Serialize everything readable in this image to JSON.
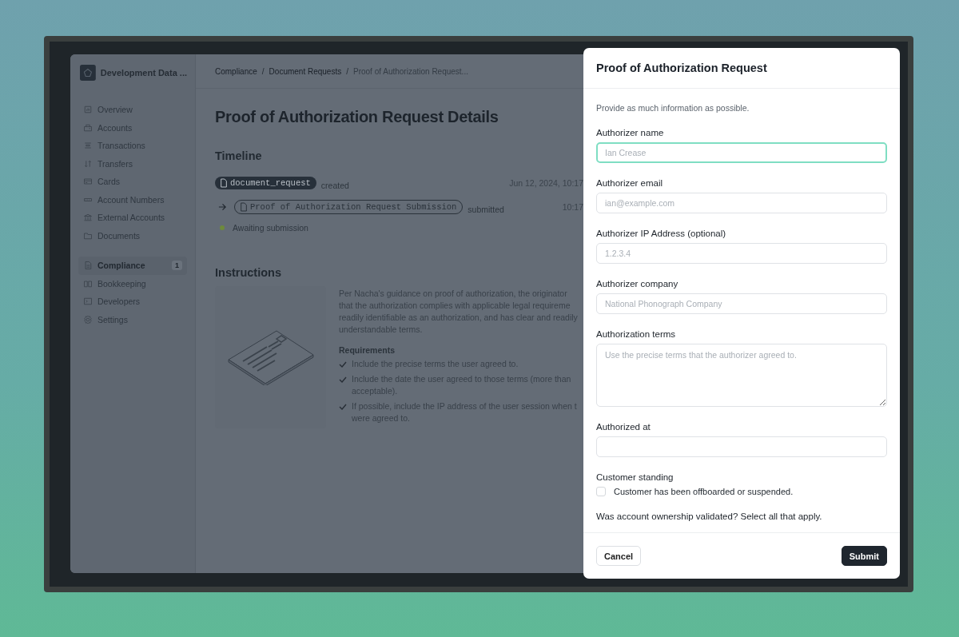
{
  "sidebar": {
    "workspace": "Development Data ...",
    "items": [
      {
        "label": "Overview",
        "selected": false
      },
      {
        "label": "Accounts",
        "selected": false
      },
      {
        "label": "Transactions",
        "selected": false
      },
      {
        "label": "Transfers",
        "selected": false
      },
      {
        "label": "Cards",
        "selected": false
      },
      {
        "label": "Account Numbers",
        "selected": false
      },
      {
        "label": "External Accounts",
        "selected": false
      },
      {
        "label": "Documents",
        "selected": false
      }
    ],
    "items2": [
      {
        "label": "Compliance",
        "selected": true,
        "count": "1"
      },
      {
        "label": "Bookkeeping",
        "selected": false
      },
      {
        "label": "Developers",
        "selected": false
      },
      {
        "label": "Settings",
        "selected": false
      }
    ]
  },
  "breadcrumb_separator": "/",
  "breadcrumb": [
    {
      "label": "Compliance",
      "current": false
    },
    {
      "label": "Document Requests",
      "current": false
    },
    {
      "label": "Proof of Authorization Request...",
      "current": true
    }
  ],
  "title": "Proof of Authorization Request Details",
  "timeline": {
    "title": "Timeline",
    "events": [
      {
        "kind": "filled",
        "tag": "document_request",
        "action": "created",
        "time": "Jun 12, 2024, 10:17"
      },
      {
        "kind": "outlined",
        "tag": "Proof of Authorization Request Submission",
        "action": "submitted",
        "time": "10:17"
      },
      {
        "kind": "pending",
        "text": "Awaiting submission"
      }
    ]
  },
  "instructions": {
    "title": "Instructions",
    "paragraph": [
      "Per Nacha's guidance on proof of authorization, the originator",
      "that the authorization complies with applicable legal requireme",
      "readily identifiable as an authorization, and has clear and readily",
      "understandable terms."
    ],
    "requirements_title": "Requirements",
    "requirements": [
      [
        "Include the precise terms the user agreed to."
      ],
      [
        "Include the date the user agreed to those terms (more than",
        "acceptable)."
      ],
      [
        "If possible, include the IP address of the user session when t",
        "were agreed to."
      ]
    ]
  },
  "modal": {
    "title": "Proof of Authorization Request",
    "intro": "Provide as much information as possible.",
    "fields": [
      {
        "kind": "input",
        "label": "Authorizer name",
        "placeholder": "Ian Crease",
        "focused": true
      },
      {
        "kind": "input",
        "label": "Authorizer email",
        "placeholder": "ian@example.com",
        "focused": false
      },
      {
        "kind": "input",
        "label": "Authorizer IP Address (optional)",
        "placeholder": "1.2.3.4",
        "focused": false
      },
      {
        "kind": "input",
        "label": "Authorizer company",
        "placeholder": "National Phonograph Company",
        "focused": false
      },
      {
        "kind": "textarea",
        "label": "Authorization terms",
        "placeholder": "Use the precise terms that the authorizer agreed to.",
        "focused": false
      },
      {
        "kind": "input",
        "label": "Authorized at",
        "focused": false
      },
      {
        "kind": "checkbox",
        "label": "Customer standing",
        "option": "Customer has been offboarded or suspended.",
        "checked": false
      },
      {
        "kind": "heading",
        "label": "Was account ownership validated? Select all that apply."
      }
    ],
    "cancel": "Cancel",
    "submit": "Submit"
  }
}
